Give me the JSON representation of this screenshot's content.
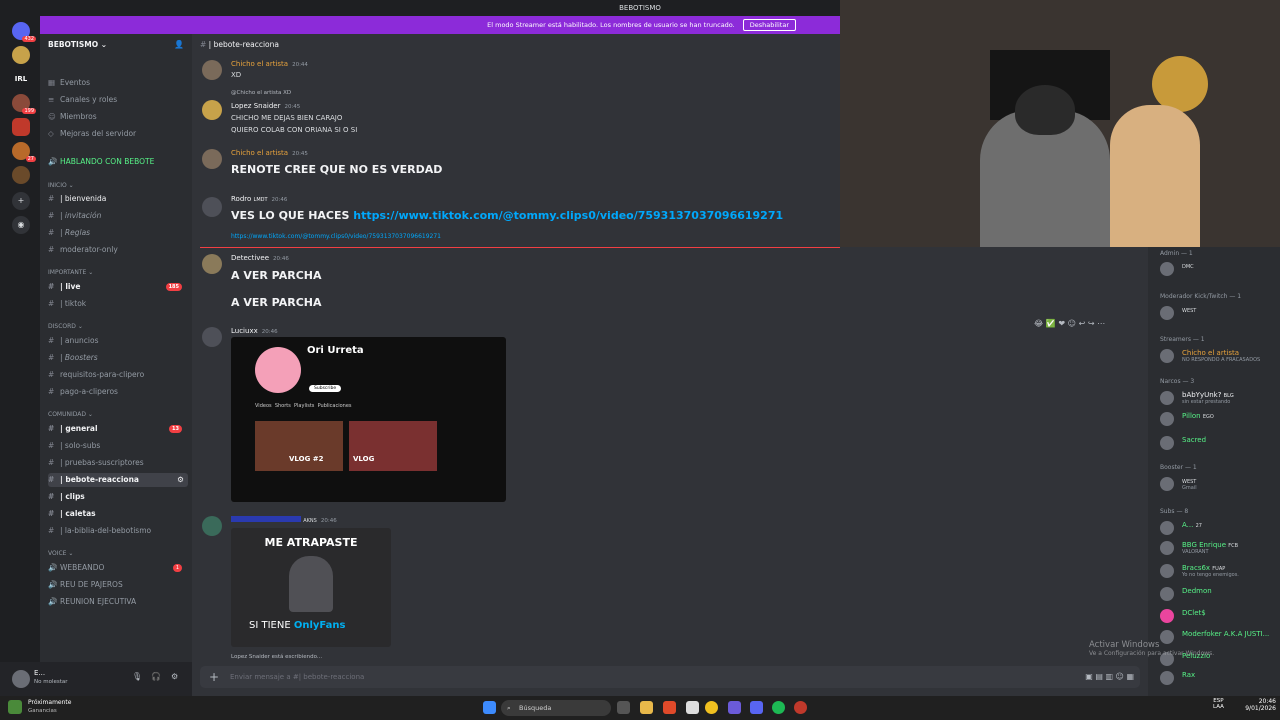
{
  "window": {
    "title": "BEBOTISMO"
  },
  "streamer_banner": {
    "text": "El modo Streamer está habilitado. Los nombres de usuario se han truncado.",
    "button": "Deshabilitar"
  },
  "rail": {
    "badges": [
      "432",
      "199",
      "27"
    ],
    "label_irl": "IRL"
  },
  "sidebar": {
    "server_name": "BEBOTISMO",
    "top": [
      "Eventos",
      "Canales y roles",
      "Miembros",
      "Mejoras del servidor"
    ],
    "highlight": "HABLANDO CON BEBOTE",
    "categories": {
      "inicio": "INICIO",
      "importante": "IMPORTANTE",
      "discord": "DISCORD",
      "comunidad": "COMUNIDAD",
      "voice": "VOICE"
    },
    "inicio": [
      "| bienvenida",
      "| invitación",
      "| Reglas",
      "moderator-only"
    ],
    "importante": [
      "| live",
      "| tiktok"
    ],
    "live_count": "185",
    "discord": [
      "| anuncios",
      "| Boosters",
      "requisitos-para-clipero",
      "pago-a-cliperos"
    ],
    "comunidad": [
      "| general",
      "| solo-subs",
      "| pruebas-suscriptores",
      "| bebote-reacciona",
      "| clips",
      "| caletas",
      "| la-biblia-del-bebotismo"
    ],
    "general_count": "13",
    "voice": [
      "WEBEANDO",
      "REU DE PAJEROS",
      "REUNION EJECUTIVA"
    ],
    "webeando_count": "1",
    "user": {
      "name": "E...",
      "status": "No molestar"
    }
  },
  "channel": {
    "name": "| bebote-reacciona"
  },
  "messages": [
    {
      "user": "Chicho el artista",
      "time": "20:44",
      "lines": [
        "XD"
      ],
      "color": "#e8a33d"
    },
    {
      "reply": "@Chicho el artista XD",
      "user": "Lopez Snaider",
      "time": "20:45",
      "lines": [
        "CHICHO ME DEJAS BIEN CARAJO",
        "QUIERO COLAB CON ORIANA SI O SI"
      ],
      "color": "#f2f3f5"
    },
    {
      "user": "Chicho el artista",
      "time": "20:45",
      "lines": [
        "RENOTE CREE QUE NO ES VERDAD"
      ],
      "color": "#e8a33d"
    },
    {
      "user": "Rodro",
      "tag": "LMDT",
      "time": "20:46",
      "prefix": "VES LO QUE HACES ",
      "link": "https://www.tiktok.com/@tommy.clips0/video/7593137037096619271",
      "link_small": "https://www.tiktok.com/@tommy.clips0/video/7593137037096619271",
      "color": "#f2f3f5"
    },
    {
      "user": "Detectivee",
      "time": "20:46",
      "lines": [
        "A VER PARCHA",
        "A VER PARCHA"
      ],
      "color": "#f2f3f5"
    },
    {
      "user": "Luciuxx",
      "time": "20:46",
      "color": "#f2f3f5"
    },
    {
      "user": "",
      "tag": "AKNS",
      "time": "20:46",
      "color": "#3b5bdb"
    }
  ],
  "embed1": {
    "channel": "Ori Urreta",
    "sub": "Subscribe",
    "tabs": [
      "Videos",
      "Shorts",
      "Playlists",
      "Publicaciones"
    ],
    "vid1": "VLOG #2",
    "vid2": "VLOG"
  },
  "embed2": {
    "top": "ME ATRAPASTE",
    "bottom": "SI TIENE",
    "brand": "OnlyFans"
  },
  "typing": "Lopez Snaider está escribiendo...",
  "input_placeholder": "Enviar mensaje a #| bebote-reacciona",
  "members": [
    {
      "role": "Admin — 1"
    },
    {
      "name": "",
      "tag": "DMC"
    },
    {
      "role": "Moderador Kick/Twitch — 1"
    },
    {
      "name": "",
      "tag": "WEST"
    },
    {
      "role": "Streamers — 1"
    },
    {
      "name": "Chicho el artista",
      "status": "NO RESPONDO A FRACASADOS",
      "color": "#e8a33d"
    },
    {
      "role": "Narcos — 3"
    },
    {
      "name": "bAbYyUnk?",
      "tag": "BLG",
      "status": "sin estar prestando",
      "color": "#f2f3f5"
    },
    {
      "name": "Pillon",
      "tag": "EGO",
      "color": "#57f287"
    },
    {
      "name": "Sacred",
      "color": "#57f287"
    },
    {
      "role": "Booster — 1"
    },
    {
      "name": "",
      "tag": "WEST",
      "status": "Gmail",
      "color": "#c084fc"
    },
    {
      "role": "Subs — 8"
    },
    {
      "name": "A...",
      "tag": "27",
      "color": "#57f287"
    },
    {
      "name": "BBG Enrique",
      "tag": "FCB",
      "status": "VALORANT",
      "color": "#57f287"
    },
    {
      "name": "Bracs6x",
      "tag": "FUAP",
      "status": "Yo no tengo enemigos.",
      "color": "#57f287"
    },
    {
      "name": "Dedmon",
      "color": "#57f287"
    },
    {
      "name": "DClet$",
      "color": "#57f287"
    },
    {
      "name": "Moderfoker A.K.A JUSTI...",
      "color": "#57f287"
    },
    {
      "name": "Peluzzio",
      "color": "#57f287"
    },
    {
      "name": "Rax",
      "color": "#57f287"
    }
  ],
  "activate": {
    "title": "Activar Windows",
    "sub": "Ve a Configuración para activar Windows."
  },
  "taskbar": {
    "weather": "Próximamente",
    "weather_sub": "Ganancias",
    "search": "Búsqueda",
    "lang": "ESP",
    "lang2": "LAA",
    "time": "20:46",
    "date": "9/01/2026"
  }
}
